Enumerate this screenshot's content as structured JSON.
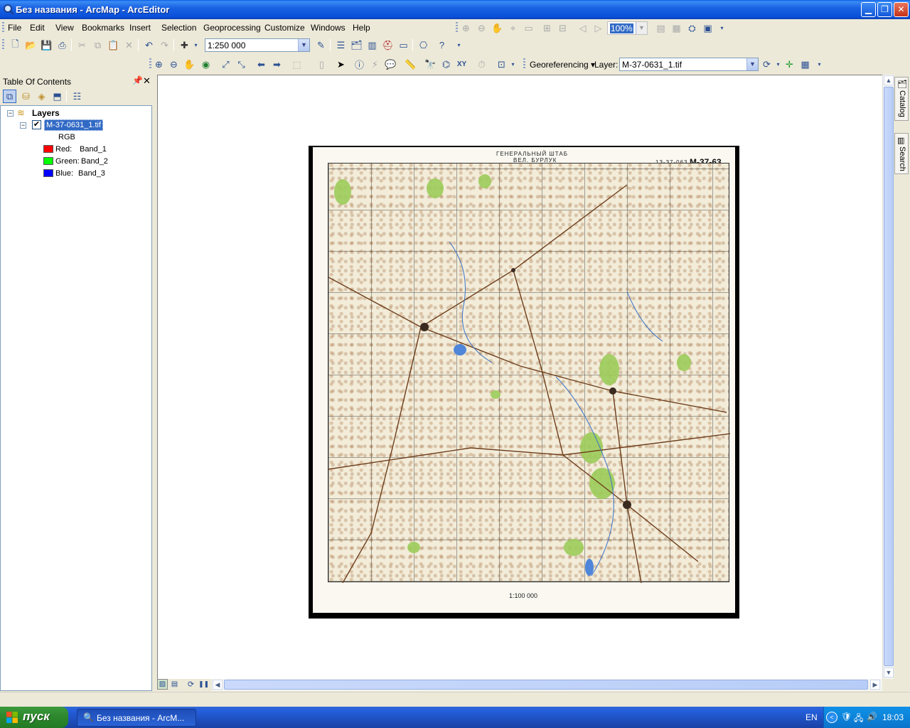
{
  "window": {
    "title": "Без названия - ArcMap - ArcEditor"
  },
  "menu": [
    "File",
    "Edit",
    "View",
    "Bookmarks",
    "Insert",
    "Selection",
    "Geoprocessing",
    "Customize",
    "Windows",
    "Help"
  ],
  "layout_toolbar": {
    "zoom_percent": "100%"
  },
  "standard_toolbar": {
    "scale": "1:250 000"
  },
  "georef_toolbar": {
    "menu_label": "Georeferencing",
    "layer_label": "Layer:",
    "layer_value": "M-37-0631_1.tif"
  },
  "toc": {
    "title": "Table Of Contents",
    "root": "Layers",
    "layer_name": "M-37-0631_1.tif",
    "renderer": "RGB",
    "bands": [
      {
        "channel": "Red:",
        "band": "Band_1",
        "color": "#ff0000"
      },
      {
        "channel": "Green:",
        "band": "Band_2",
        "color": "#00ff00"
      },
      {
        "channel": "Blue:",
        "band": "Band_3",
        "color": "#0000ff"
      }
    ]
  },
  "map": {
    "sheet_title_1": "ГЕНЕРАЛЬНЫЙ ШТАБ",
    "sheet_title_2": "ВЕЛ. БУРЛУК",
    "sheet_code": "13-37-063",
    "sheet_number": "M-37-63",
    "scale_text": "1:100 000"
  },
  "dock": {
    "catalog": "Catalog",
    "search": "Search"
  },
  "taskbar": {
    "start": "пуск",
    "window_item": "Без названия - ArcM...",
    "lang": "EN",
    "clock": "18:03"
  }
}
